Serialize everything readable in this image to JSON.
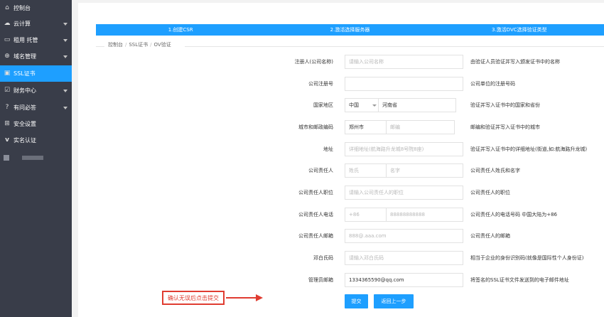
{
  "sidebar": {
    "items": [
      {
        "label": "控制台",
        "icon": "home-icon",
        "has_caret": false
      },
      {
        "label": "云计算",
        "icon": "cloud-icon",
        "has_caret": true
      },
      {
        "label": "租用 托管",
        "icon": "monitor-icon",
        "has_caret": true
      },
      {
        "label": "域名管理",
        "icon": "globe-icon",
        "has_caret": true
      },
      {
        "label": "SSL证书",
        "icon": "certificate-icon",
        "has_caret": false,
        "active": true
      },
      {
        "label": "财务中心",
        "icon": "finance-icon",
        "has_caret": true
      },
      {
        "label": "有问必答",
        "icon": "question-icon",
        "has_caret": true
      },
      {
        "label": "安全设置",
        "icon": "grid-icon",
        "has_caret": false
      },
      {
        "label": "实名认证",
        "icon": "v-icon",
        "has_caret": false
      }
    ]
  },
  "steps": [
    "1.创建CSR",
    "2.激活选择服务器",
    "3.激活DVC选择验证类型"
  ],
  "breadcrumb": [
    "控制台",
    "SSL证书",
    "OV验证"
  ],
  "form": {
    "company_name": {
      "label": "注册人(公司名称)",
      "placeholder": "请输入公司名称",
      "note": "由验证人员验证并写入颁发证书中的名称"
    },
    "reg_no": {
      "label": "公司注册号",
      "value": "",
      "note": "公司单位的注册号码"
    },
    "region": {
      "label": "国家地区",
      "country": "中国",
      "province": "河南省",
      "note": "验证并写入证书中的国家和省份"
    },
    "city_zip": {
      "label": "城市和邮政编码",
      "city": "郑州市",
      "zip_placeholder": "邮编",
      "note": "邮编和验证并写入证书中的城市"
    },
    "address": {
      "label": "地址",
      "placeholder": "详细地址(航海路升龙城8号院8座)",
      "note": "验证并写入证书中的详细地址(街道,如:航海路升龙城)"
    },
    "owner": {
      "label": "公司责任人",
      "last_placeholder": "姓氏",
      "first_placeholder": "名字",
      "note": "公司责任人姓氏和名字"
    },
    "owner_title": {
      "label": "公司责任人职位",
      "placeholder": "请输入公司责任人的职位",
      "note": "公司责任人的职位"
    },
    "owner_phone": {
      "label": "公司责任人电话",
      "code_placeholder": "+86",
      "phone_placeholder": "88888888888",
      "note": "公司责任人的电话号码 中国大陆为+86"
    },
    "owner_email": {
      "label": "公司责任人邮箱",
      "placeholder": "888@.aaa.com",
      "note": "公司责任人的邮箱"
    },
    "duns": {
      "label": "邓白氏码",
      "placeholder": "请输入邓白氏码",
      "note": "相当于企业的身份识别码(就像是国际性个人身份证)"
    },
    "admin_email": {
      "label": "管理员邮箱",
      "value": "1334365590@qq.com",
      "note": "将签名的SSL证书文件发送到的电子邮件地址"
    }
  },
  "buttons": {
    "submit": "提交",
    "back": "返回上一步"
  },
  "annotation": {
    "text": "确认无误后点击提交"
  },
  "colors": {
    "sidebar_bg": "#393d49",
    "accent": "#1e9fff",
    "annotation": "#e03c31"
  }
}
